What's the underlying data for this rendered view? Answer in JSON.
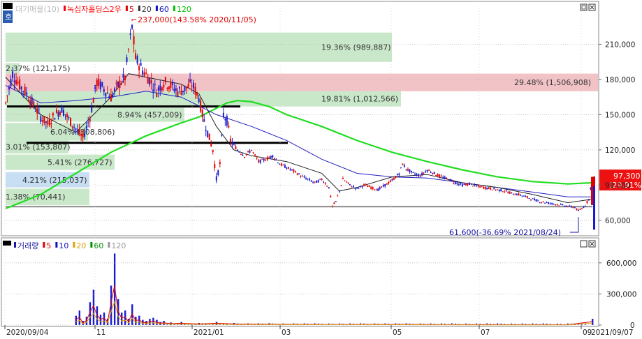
{
  "header": {
    "top_corner_label": "호",
    "items": [
      {
        "text": "대기매물(10)",
        "color": "#bbbbbb"
      },
      {
        "text": "녹십자홀딩스2우",
        "color": "#ff0000"
      },
      {
        "text": "5",
        "color": "#e00000"
      },
      {
        "text": "20",
        "color": "#333333"
      },
      {
        "text": "60",
        "color": "#1010c0"
      },
      {
        "text": "120",
        "color": "#00c000"
      }
    ],
    "volume_items": [
      {
        "text": "거래량",
        "color": "#1a1aa6"
      },
      {
        "text": "5",
        "color": "#e00000"
      },
      {
        "text": "10",
        "color": "#1010c0"
      },
      {
        "text": "20",
        "color": "#e0a000"
      },
      {
        "text": "60",
        "color": "#009000"
      },
      {
        "text": "120",
        "color": "#999999"
      }
    ]
  },
  "chart_data": [
    {
      "type": "candlestick",
      "title": "녹십자홀딩스2우",
      "yticks": [
        60000,
        90000,
        120000,
        150000,
        180000,
        210000
      ],
      "ytick_labels": [
        "60,000",
        "90,000",
        "120,000",
        "150,000",
        "180,000",
        "210,000"
      ],
      "ylim": [
        48000,
        243000
      ],
      "x_range": [
        "2020/09/04",
        "2021/09/07"
      ],
      "xtick_labels": [
        "2020/09/04",
        "11",
        "2021/01",
        "03",
        "05",
        "07",
        "09",
        "2021/09/07"
      ],
      "volume_profile": [
        {
          "label": "19.36% (989,887)",
          "from": 195000,
          "to": 220000,
          "color": "#c6e6c6"
        },
        {
          "label": "29.48% (1,506,908)",
          "from": 170000,
          "to": 185000,
          "color": "#f0bfc3"
        },
        {
          "label": "19.81% (1,012,566)",
          "from": 157000,
          "to": 170000,
          "color": "#c6e6c6"
        },
        {
          "label": "8.94% (457,009)",
          "from": 144000,
          "to": 156000,
          "color": "#c6e6c6"
        },
        {
          "label": "6.04% (308,806)",
          "from": 128000,
          "to": 143000,
          "color": "#c6e6c6"
        },
        {
          "label": "3.01% (153,807)",
          "from": 117000,
          "to": 128000,
          "color": "#c6e6c6"
        },
        {
          "label": "5.41% (276,727)",
          "from": 103000,
          "to": 116000,
          "color": "#c6e6c6"
        },
        {
          "label": "4.21% (215,037)",
          "from": 88000,
          "to": 101000,
          "color": "#c4dcf2"
        },
        {
          "label": "1.38% (70,441)",
          "from": 73000,
          "to": 87000,
          "color": "#c6e6c6"
        },
        {
          "label": "2.37% (121,175)",
          "from": 185000,
          "to": 194000,
          "color": "#c6e6c6"
        }
      ],
      "horizontal_lines": [
        157000,
        126000,
        71600
      ],
      "annotations": [
        {
          "text": "237,000(143.58% 2020/11/05)",
          "color": "#e00000",
          "price": 237000
        },
        {
          "text": "61,600(-36.69% 2021/08/24)",
          "color": "#1010a0",
          "price": 61600
        }
      ],
      "current_price": {
        "text": "97,300",
        "change": "(29.91%)"
      },
      "price_path": [
        [
          0,
          160000
        ],
        [
          4,
          185000
        ],
        [
          8,
          175000
        ],
        [
          12,
          168000
        ],
        [
          16,
          158000
        ],
        [
          20,
          148000
        ],
        [
          24,
          142000
        ],
        [
          28,
          150000
        ],
        [
          32,
          155000
        ],
        [
          36,
          146000
        ],
        [
          40,
          138000
        ],
        [
          44,
          130000
        ],
        [
          48,
          148000
        ],
        [
          52,
          178000
        ],
        [
          56,
          172000
        ],
        [
          60,
          165000
        ],
        [
          64,
          175000
        ],
        [
          68,
          182000
        ],
        [
          70,
          205000
        ],
        [
          72,
          225000
        ],
        [
          74,
          198000
        ],
        [
          78,
          188000
        ],
        [
          82,
          180000
        ],
        [
          86,
          170000
        ],
        [
          90,
          178000
        ],
        [
          94,
          175000
        ],
        [
          98,
          170000
        ],
        [
          102,
          172000
        ],
        [
          106,
          176000
        ],
        [
          110,
          165000
        ],
        [
          112,
          150000
        ],
        [
          116,
          130000
        ],
        [
          118,
          120000
        ],
        [
          120,
          95000
        ],
        [
          122,
          108000
        ],
        [
          124,
          150000
        ],
        [
          126,
          145000
        ],
        [
          128,
          128000
        ],
        [
          132,
          120000
        ],
        [
          136,
          115000
        ],
        [
          140,
          120000
        ],
        [
          144,
          110000
        ],
        [
          148,
          112000
        ],
        [
          152,
          115000
        ],
        [
          156,
          108000
        ],
        [
          160,
          105000
        ],
        [
          164,
          102000
        ],
        [
          168,
          98000
        ],
        [
          172,
          95000
        ],
        [
          176,
          92000
        ],
        [
          180,
          95000
        ],
        [
          184,
          88000
        ],
        [
          186,
          72000
        ],
        [
          188,
          76000
        ],
        [
          190,
          85000
        ],
        [
          192,
          95000
        ],
        [
          196,
          90000
        ],
        [
          200,
          87000
        ],
        [
          204,
          90000
        ],
        [
          208,
          88000
        ],
        [
          212,
          86000
        ],
        [
          216,
          90000
        ],
        [
          220,
          94000
        ],
        [
          224,
          100000
        ],
        [
          226,
          108000
        ],
        [
          228,
          104000
        ],
        [
          232,
          100000
        ],
        [
          236,
          98000
        ],
        [
          240,
          103000
        ],
        [
          244,
          100000
        ],
        [
          248,
          97000
        ],
        [
          252,
          95000
        ],
        [
          256,
          92000
        ],
        [
          260,
          90000
        ],
        [
          264,
          91000
        ],
        [
          268,
          89000
        ],
        [
          272,
          88000
        ],
        [
          276,
          87000
        ],
        [
          280,
          86000
        ],
        [
          284,
          85000
        ],
        [
          288,
          83000
        ],
        [
          292,
          82000
        ],
        [
          296,
          80000
        ],
        [
          300,
          78000
        ],
        [
          304,
          76000
        ],
        [
          308,
          75000
        ],
        [
          312,
          74000
        ],
        [
          316,
          73000
        ],
        [
          320,
          72000
        ],
        [
          324,
          71000
        ],
        [
          326,
          68000
        ],
        [
          328,
          70000
        ],
        [
          330,
          73000
        ],
        [
          332,
          78000
        ],
        [
          334,
          97000
        ]
      ],
      "ma120_path": [
        [
          0,
          70000
        ],
        [
          20,
          82000
        ],
        [
          40,
          100000
        ],
        [
          60,
          118000
        ],
        [
          80,
          132000
        ],
        [
          100,
          143000
        ],
        [
          110,
          148000
        ],
        [
          118,
          154000
        ],
        [
          126,
          160000
        ],
        [
          132,
          162000
        ],
        [
          140,
          161000
        ],
        [
          150,
          157000
        ],
        [
          160,
          150000
        ],
        [
          180,
          140000
        ],
        [
          200,
          128000
        ],
        [
          220,
          118000
        ],
        [
          240,
          110000
        ],
        [
          260,
          103000
        ],
        [
          280,
          97000
        ],
        [
          300,
          93000
        ],
        [
          320,
          91000
        ],
        [
          334,
          92000
        ]
      ],
      "ma60_path": [
        [
          0,
          175000
        ],
        [
          20,
          160000
        ],
        [
          40,
          162000
        ],
        [
          60,
          165000
        ],
        [
          80,
          170000
        ],
        [
          100,
          165000
        ],
        [
          120,
          150000
        ],
        [
          140,
          140000
        ],
        [
          160,
          128000
        ],
        [
          180,
          112000
        ],
        [
          200,
          100000
        ],
        [
          220,
          97000
        ],
        [
          240,
          96000
        ],
        [
          260,
          92000
        ],
        [
          280,
          88000
        ],
        [
          300,
          84000
        ],
        [
          320,
          80000
        ],
        [
          334,
          80000
        ]
      ],
      "ma20_path": [
        [
          0,
          182000
        ],
        [
          20,
          150000
        ],
        [
          40,
          135000
        ],
        [
          60,
          165000
        ],
        [
          70,
          185000
        ],
        [
          80,
          182000
        ],
        [
          100,
          176000
        ],
        [
          110,
          168000
        ],
        [
          120,
          140000
        ],
        [
          130,
          120000
        ],
        [
          140,
          115000
        ],
        [
          160,
          110000
        ],
        [
          180,
          100000
        ],
        [
          190,
          85000
        ],
        [
          200,
          88000
        ],
        [
          220,
          97000
        ],
        [
          240,
          99000
        ],
        [
          260,
          92000
        ],
        [
          280,
          88000
        ],
        [
          300,
          82000
        ],
        [
          320,
          75000
        ],
        [
          334,
          78000
        ]
      ]
    },
    {
      "type": "bar",
      "title": "거래량",
      "yticks": [
        0,
        300000,
        600000
      ],
      "ytick_labels": [
        "0",
        "300,000",
        "600,000"
      ],
      "ylim": [
        0,
        740000
      ],
      "volume_series": [
        [
          40,
          90000
        ],
        [
          42,
          140000
        ],
        [
          44,
          40000
        ],
        [
          46,
          80000
        ],
        [
          48,
          220000
        ],
        [
          50,
          340000
        ],
        [
          52,
          180000
        ],
        [
          54,
          100000
        ],
        [
          56,
          120000
        ],
        [
          58,
          60000
        ],
        [
          60,
          380000
        ],
        [
          62,
          690000
        ],
        [
          64,
          250000
        ],
        [
          66,
          120000
        ],
        [
          68,
          140000
        ],
        [
          70,
          60000
        ],
        [
          72,
          200000
        ],
        [
          74,
          80000
        ],
        [
          76,
          90000
        ],
        [
          78,
          50000
        ],
        [
          80,
          40000
        ],
        [
          82,
          60000
        ],
        [
          84,
          70000
        ],
        [
          86,
          50000
        ],
        [
          88,
          30000
        ],
        [
          90,
          40000
        ],
        [
          94,
          25000
        ],
        [
          100,
          30000
        ],
        [
          110,
          20000
        ],
        [
          120,
          30000
        ],
        [
          130,
          20000
        ],
        [
          150,
          15000
        ],
        [
          180,
          10000
        ],
        [
          210,
          12000
        ],
        [
          240,
          8000
        ],
        [
          270,
          7000
        ],
        [
          300,
          6000
        ],
        [
          320,
          6000
        ],
        [
          334,
          60000
        ]
      ]
    }
  ]
}
